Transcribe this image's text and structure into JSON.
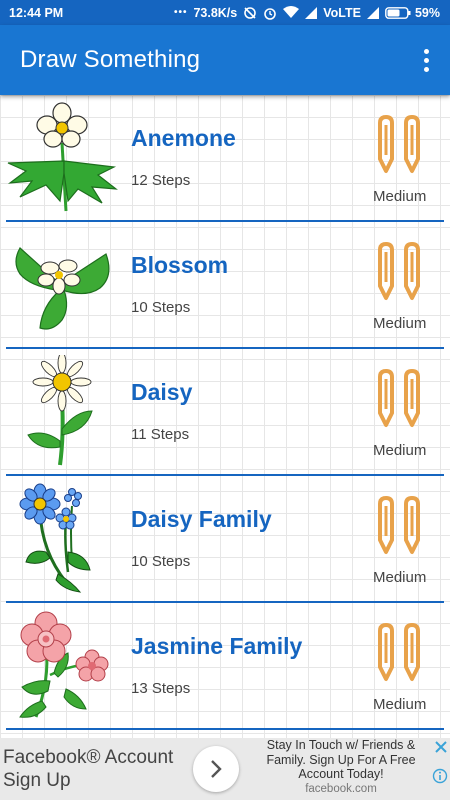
{
  "status_bar": {
    "time": "12:44 PM",
    "net_speed": "73.8K/s",
    "network_label": "VoLTE",
    "battery_percent": "59%"
  },
  "app_bar": {
    "title": "Draw Something",
    "menu_icon": "more-vert-icon"
  },
  "items": [
    {
      "title": "Anemone",
      "steps": "12 Steps",
      "difficulty": "Medium",
      "thumbnail": "anemone-flower"
    },
    {
      "title": "Blossom",
      "steps": "10 Steps",
      "difficulty": "Medium",
      "thumbnail": "blossom-flower"
    },
    {
      "title": "Daisy",
      "steps": "11 Steps",
      "difficulty": "Medium",
      "thumbnail": "daisy-flower"
    },
    {
      "title": "Daisy Family",
      "steps": "10 Steps",
      "difficulty": "Medium",
      "thumbnail": "daisy-family-flower"
    },
    {
      "title": "Jasmine Family",
      "steps": "13 Steps",
      "difficulty": "Medium",
      "thumbnail": "jasmine-family-flower"
    }
  ],
  "ad": {
    "headline": "Facebook® Account Sign Up",
    "body": "Stay In Touch w/ Friends & Family. Sign Up For A Free Account Today!",
    "url": "facebook.com"
  },
  "colors": {
    "primary": "#1976d2",
    "primary_dark": "#1565c0",
    "pencil": "#e8a24a",
    "leaf": "#2e9e2e"
  }
}
